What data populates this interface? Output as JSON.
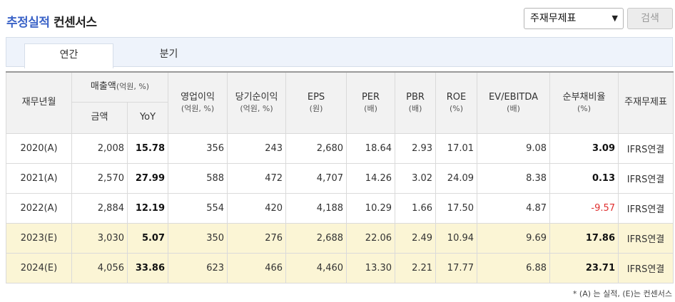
{
  "header": {
    "title_accent": "추정실적",
    "title_rest": "컨센서스"
  },
  "controls": {
    "select_value": "주재무제표",
    "search_label": "검색"
  },
  "tabs": [
    {
      "label": "연간",
      "active": true
    },
    {
      "label": "분기",
      "active": false
    }
  ],
  "table": {
    "headers": {
      "year": "재무년월",
      "sales": "매출액",
      "sales_unit": "(억원, %)",
      "amount": "금액",
      "yoy": "YoY",
      "op": "영업이익",
      "op_unit": "(억원, %)",
      "net": "당기순이익",
      "net_unit": "(억원, %)",
      "eps": "EPS",
      "eps_unit": "(원)",
      "per": "PER",
      "per_unit": "(배)",
      "pbr": "PBR",
      "pbr_unit": "(배)",
      "roe": "ROE",
      "roe_unit": "(%)",
      "ev": "EV/EBITDA",
      "ev_unit": "(배)",
      "debt": "순부채비율",
      "debt_unit": "(%)",
      "std": "주재무제표"
    },
    "rows": [
      {
        "year": "2020(A)",
        "amount": "2,008",
        "yoy": "15.78",
        "op": "356",
        "net": "243",
        "eps": "2,680",
        "per": "18.64",
        "pbr": "2.93",
        "roe": "17.01",
        "ev": "9.08",
        "debt": "3.09",
        "std": "IFRS연결"
      },
      {
        "year": "2021(A)",
        "amount": "2,570",
        "yoy": "27.99",
        "op": "588",
        "net": "472",
        "eps": "4,707",
        "per": "14.26",
        "pbr": "3.02",
        "roe": "24.09",
        "ev": "8.38",
        "debt": "0.13",
        "std": "IFRS연결"
      },
      {
        "year": "2022(A)",
        "amount": "2,884",
        "yoy": "12.19",
        "op": "554",
        "net": "420",
        "eps": "4,188",
        "per": "10.29",
        "pbr": "1.66",
        "roe": "17.50",
        "ev": "4.87",
        "debt": "-9.57",
        "std": "IFRS연결"
      },
      {
        "year": "2023(E)",
        "amount": "3,030",
        "yoy": "5.07",
        "op": "350",
        "net": "276",
        "eps": "2,688",
        "per": "22.06",
        "pbr": "2.49",
        "roe": "10.94",
        "ev": "9.69",
        "debt": "17.86",
        "std": "IFRS연결"
      },
      {
        "year": "2024(E)",
        "amount": "4,056",
        "yoy": "33.86",
        "op": "623",
        "net": "466",
        "eps": "4,460",
        "per": "13.30",
        "pbr": "2.21",
        "roe": "17.77",
        "ev": "6.88",
        "debt": "23.71",
        "std": "IFRS연결"
      }
    ]
  },
  "footnote": "* (A) 는 실적, (E)는 컨센서스",
  "colors": {
    "accent": "#3b63c7",
    "estimate_row": "#fbf5d5",
    "negative": "#e03030"
  },
  "icons": {
    "select_arrow": "chevron-down-icon"
  }
}
